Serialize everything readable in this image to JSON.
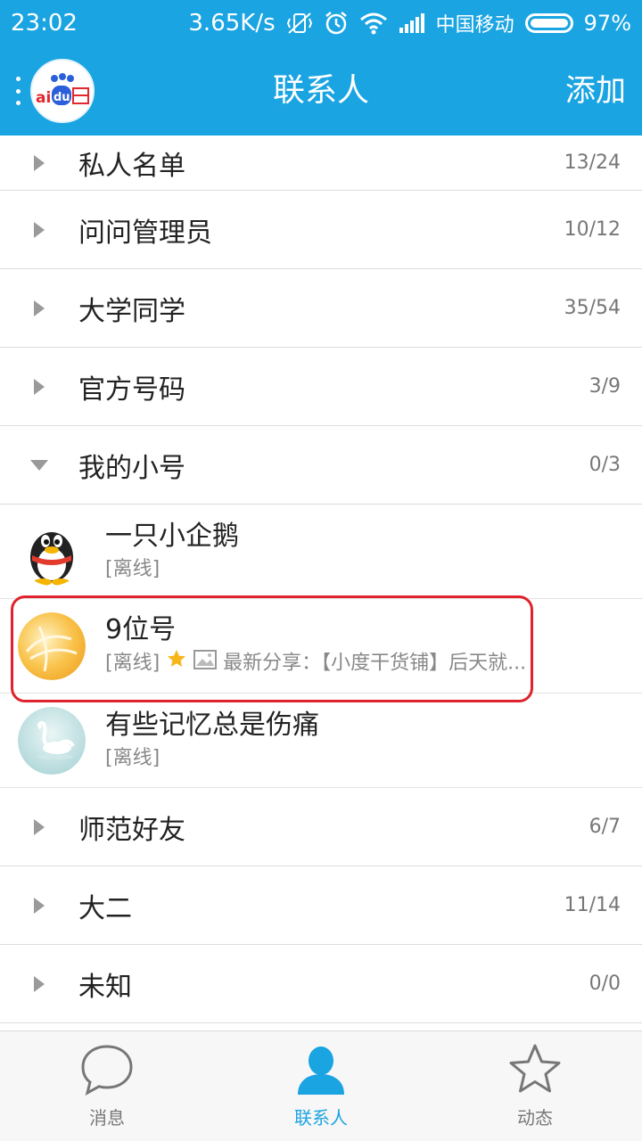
{
  "status_bar": {
    "time": "23:02",
    "speed": "3.65K/s",
    "carrier": "中国移动",
    "battery": "97%"
  },
  "app_bar": {
    "title": "联系人",
    "add_label": "添加",
    "avatar_icon": "baidu-logo-icon"
  },
  "groups_top": [
    {
      "name": "私人名单",
      "count": "13/24",
      "expanded": false
    },
    {
      "name": "问问管理员",
      "count": "10/12",
      "expanded": false
    },
    {
      "name": "大学同学",
      "count": "35/54",
      "expanded": false
    },
    {
      "name": "官方号码",
      "count": "3/9",
      "expanded": false
    },
    {
      "name": "我的小号",
      "count": "0/3",
      "expanded": true
    }
  ],
  "contacts": [
    {
      "name": "一只小企鹅",
      "status": "[离线]",
      "share": ""
    },
    {
      "name": "9位号",
      "status": "[离线]",
      "share": "最新分享：【小度干货铺】后天就..."
    },
    {
      "name": "有些记忆总是伤痛",
      "status": "[离线]",
      "share": ""
    }
  ],
  "groups_bottom": [
    {
      "name": "师范好友",
      "count": "6/7",
      "expanded": false
    },
    {
      "name": "大二",
      "count": "11/14",
      "expanded": false
    },
    {
      "name": "未知",
      "count": "0/0",
      "expanded": false
    }
  ],
  "tabs": [
    {
      "label": "消息",
      "icon": "chat-bubble-icon",
      "active": false
    },
    {
      "label": "联系人",
      "icon": "person-icon",
      "active": true
    },
    {
      "label": "动态",
      "icon": "star-icon",
      "active": false
    }
  ],
  "colors": {
    "accent": "#1aa4e2",
    "highlight": "#e0222c"
  }
}
